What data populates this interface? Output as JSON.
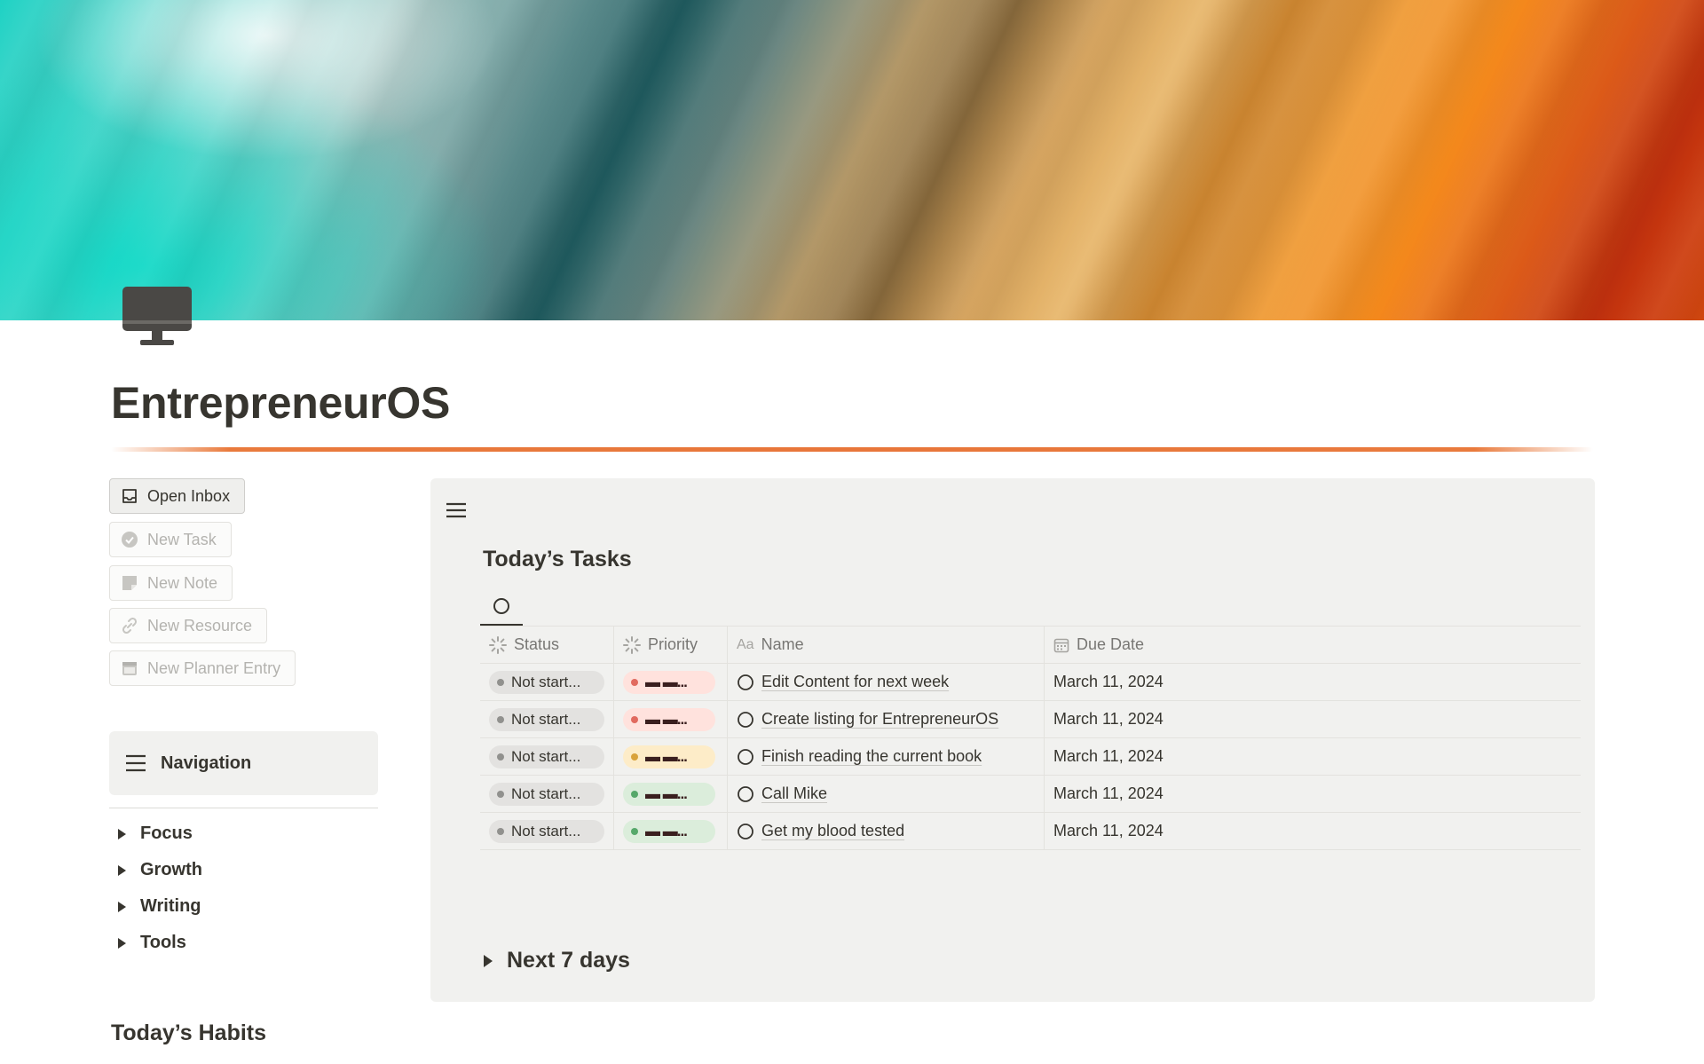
{
  "page": {
    "title": "EntrepreneurOS",
    "icon": "desktop-computer-icon",
    "accent_color": "#e8763a"
  },
  "buttons": [
    {
      "label": "Open Inbox",
      "icon": "inbox-icon"
    },
    {
      "label": "New Task",
      "icon": "check-circle-icon"
    },
    {
      "label": "New Note",
      "icon": "sticky-note-icon"
    },
    {
      "label": "New Resource",
      "icon": "link-icon"
    },
    {
      "label": "New Planner Entry",
      "icon": "calendar-icon"
    }
  ],
  "navigation": {
    "title": "Navigation",
    "items": [
      "Focus",
      "Growth",
      "Writing",
      "Tools"
    ]
  },
  "habits": {
    "title": "Today’s Habits"
  },
  "tasks": {
    "title": "Today’s Tasks",
    "columns": {
      "status": "Status",
      "priority": "Priority",
      "name_icon": "Aa",
      "name": "Name",
      "due": "Due Date"
    },
    "rows": [
      {
        "status": "Not start...",
        "priority": "▬ ▬...",
        "priority_color": "#ffe2dd",
        "priority_dot": "#e16a5f",
        "name": "Edit Content for next week",
        "due": "March 11, 2024"
      },
      {
        "status": "Not start...",
        "priority": "▬ ▬...",
        "priority_color": "#ffe2dd",
        "priority_dot": "#e16a5f",
        "name": "Create listing for EntrepreneurOS",
        "due": "March 11, 2024"
      },
      {
        "status": "Not start...",
        "priority": "▬ ▬...",
        "priority_color": "#fdecc8",
        "priority_dot": "#d9a23b",
        "name": "Finish reading the current book",
        "due": "March 11, 2024"
      },
      {
        "status": "Not start...",
        "priority": "▬ ▬...",
        "priority_color": "#dbeddb",
        "priority_dot": "#56a86a",
        "name": "Call Mike",
        "due": "March 11, 2024"
      },
      {
        "status": "Not start...",
        "priority": "▬ ▬...",
        "priority_color": "#dbeddb",
        "priority_dot": "#56a86a",
        "name": "Get my blood tested",
        "due": "March 11, 2024"
      }
    ],
    "next_section": "Next 7 days"
  }
}
